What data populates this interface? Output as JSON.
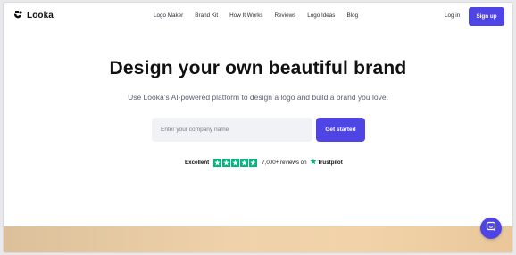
{
  "brand": {
    "name": "Looka",
    "accent": "#4f45e4"
  },
  "nav": {
    "items": [
      {
        "label": "Logo Maker"
      },
      {
        "label": "Brand Kit"
      },
      {
        "label": "How It Works"
      },
      {
        "label": "Reviews"
      },
      {
        "label": "Logo Ideas"
      },
      {
        "label": "Blog"
      }
    ],
    "login_label": "Log in",
    "signup_label": "Sign up"
  },
  "hero": {
    "headline": "Design your own beautiful brand",
    "subheadline": "Use Looka’s AI-powered platform to design a logo and build a brand you love.",
    "input_placeholder": "Enter your company name",
    "cta_label": "Get started"
  },
  "trust": {
    "rating_label": "Excellent",
    "star_count": 5,
    "star_color": "#00b67a",
    "reviews_text": "7,000+ reviews on",
    "provider": "Trustpilot"
  },
  "icons": {
    "logo": "looka-logo-icon",
    "star": "star-icon",
    "trustpilot": "trustpilot-star-icon",
    "chat": "chat-icon"
  }
}
